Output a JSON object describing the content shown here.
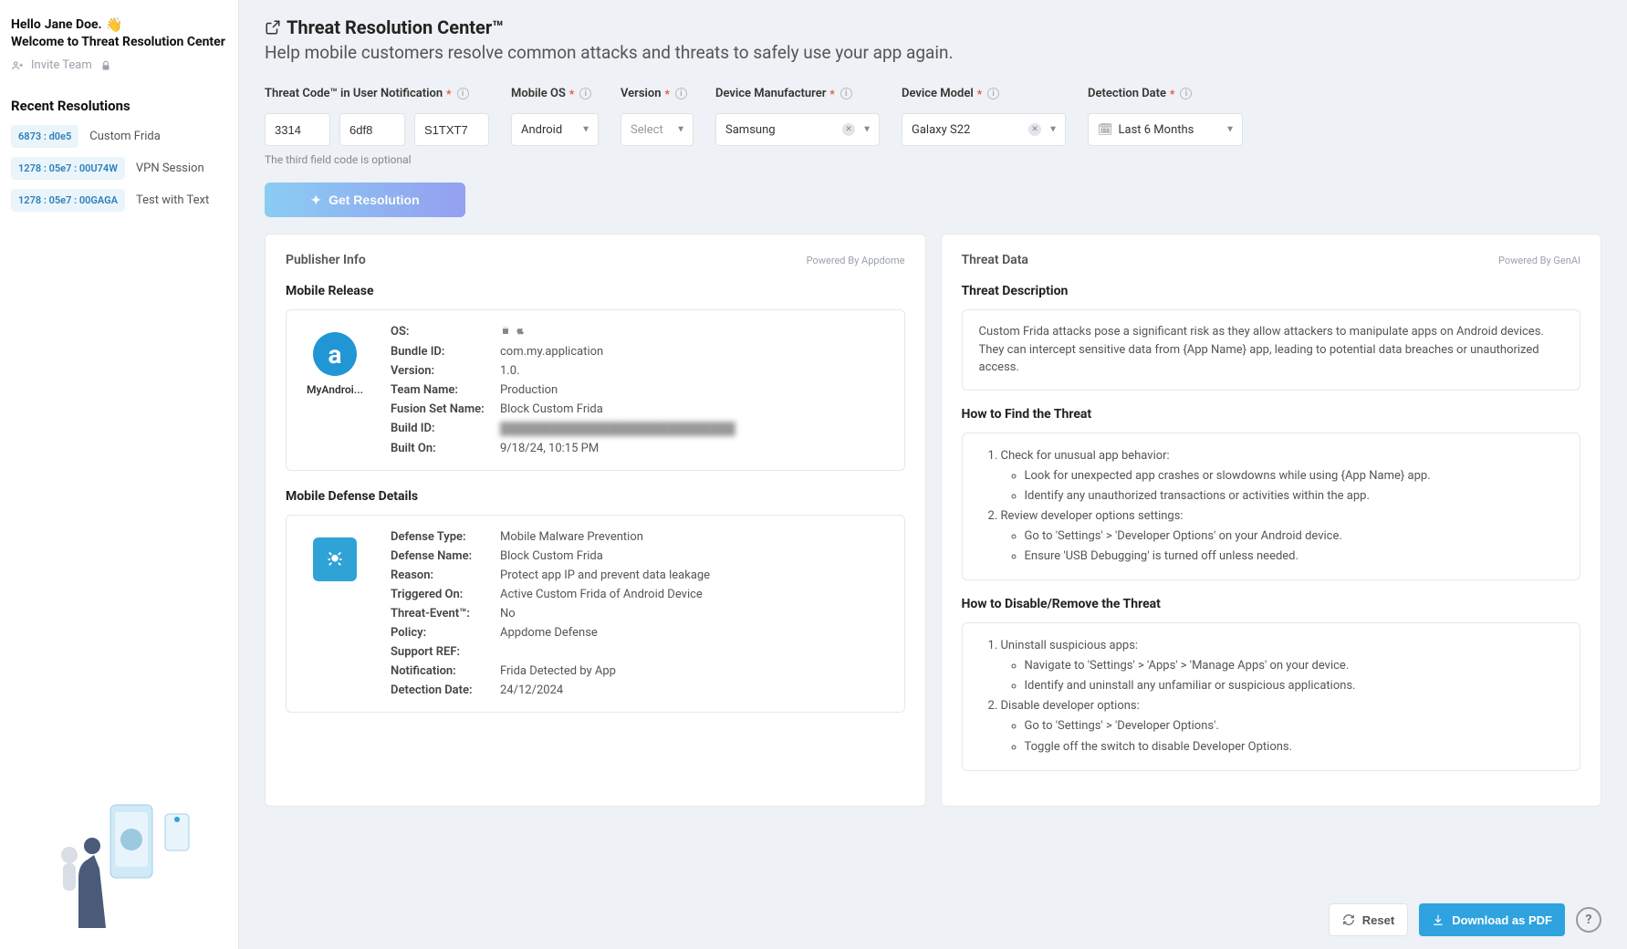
{
  "sidebar": {
    "greeting_prefix": "Hello ",
    "user_name": "Jane Doe.",
    "welcome": "Welcome to Threat Resolution Center",
    "invite_label": "Invite Team",
    "recent_title": "Recent Resolutions",
    "recent": [
      {
        "code": "6873 : d0e5",
        "label": "Custom Frida"
      },
      {
        "code": "1278 : 05e7 : 00U74W",
        "label": "VPN Session"
      },
      {
        "code": "1278 : 05e7 : 00GAGA",
        "label": "Test with Text"
      }
    ]
  },
  "page": {
    "title": "Threat Resolution Center™",
    "subtitle": "Help mobile customers resolve common attacks and threats to safely use your app again."
  },
  "filters": {
    "threat_code_label": "Threat Code™ in User Notification",
    "threat_code": {
      "a": "3314",
      "b": "6df8",
      "c": "S1TXT7"
    },
    "threat_code_hint": "The third field code is optional",
    "os_label": "Mobile OS",
    "os_value": "Android",
    "version_label": "Version",
    "version_value": "Select",
    "manufacturer_label": "Device Manufacturer",
    "manufacturer_value": "Samsung",
    "model_label": "Device Model",
    "model_value": "Galaxy S22",
    "date_label": "Detection Date",
    "date_value": "Last 6 Months",
    "get_resolution_label": "Get Resolution"
  },
  "publisher": {
    "panel_title": "Publisher Info",
    "powered": "Powered By Appdome",
    "release_title": "Mobile Release",
    "app_name": "MyAndroi...",
    "rows": {
      "os_k": "OS:",
      "os_v": "android+ios",
      "bundle_k": "Bundle ID:",
      "bundle_v": "com.my.application",
      "ver_k": "Version:",
      "ver_v": "1.0.",
      "team_k": "Team Name:",
      "team_v": "Production",
      "fusion_k": "Fusion Set Name:",
      "fusion_v": "Block Custom Frida",
      "build_k": "Build ID:",
      "build_v": "████████████████████████████",
      "built_k": "Built On:",
      "built_v": "9/18/24, 10:15 PM"
    },
    "defense_title": "Mobile Defense Details",
    "defense": {
      "type_k": "Defense Type:",
      "type_v": "Mobile Malware Prevention",
      "name_k": "Defense Name:",
      "name_v": "Block Custom Frida",
      "reason_k": "Reason:",
      "reason_v": "Protect app IP and prevent data leakage",
      "trig_k": "Triggered On:",
      "trig_v": "Active Custom Frida of Android Device",
      "event_k": "Threat-Event™:",
      "event_v": "No",
      "policy_k": "Policy:",
      "policy_v": "Appdome Defense",
      "support_k": "Support REF:",
      "support_v": "",
      "notif_k": "Notification:",
      "notif_v": "Frida Detected by App",
      "detect_k": "Detection Date:",
      "detect_v": "24/12/2024"
    }
  },
  "threat": {
    "panel_title": "Threat Data",
    "powered": "Powered By GenAI",
    "desc_title": "Threat Description",
    "desc": "Custom Frida attacks pose a significant risk as they allow attackers to manipulate apps on Android devices. They can intercept sensitive data from {App Name} app, leading to potential data breaches or unauthorized access.",
    "find_title": "How to Find the Threat",
    "find": [
      {
        "step": "Check for unusual app behavior:",
        "subs": [
          "Look for unexpected app crashes or slowdowns while using {App Name} app.",
          "Identify any unauthorized transactions or activities within the app."
        ]
      },
      {
        "step": "Review developer options settings:",
        "subs": [
          "Go to 'Settings' > 'Developer Options' on your Android device.",
          "Ensure 'USB Debugging' is turned off unless needed."
        ]
      }
    ],
    "remove_title": "How to Disable/Remove the Threat",
    "remove": [
      {
        "step": "Uninstall suspicious apps:",
        "subs": [
          "Navigate to 'Settings' > 'Apps' > 'Manage Apps' on your device.",
          "Identify and uninstall any unfamiliar or suspicious applications."
        ]
      },
      {
        "step": "Disable developer options:",
        "subs": [
          "Go to 'Settings' > 'Developer Options'.",
          "Toggle off the switch to disable Developer Options."
        ]
      }
    ]
  },
  "footer": {
    "reset": "Reset",
    "download": "Download as PDF"
  }
}
